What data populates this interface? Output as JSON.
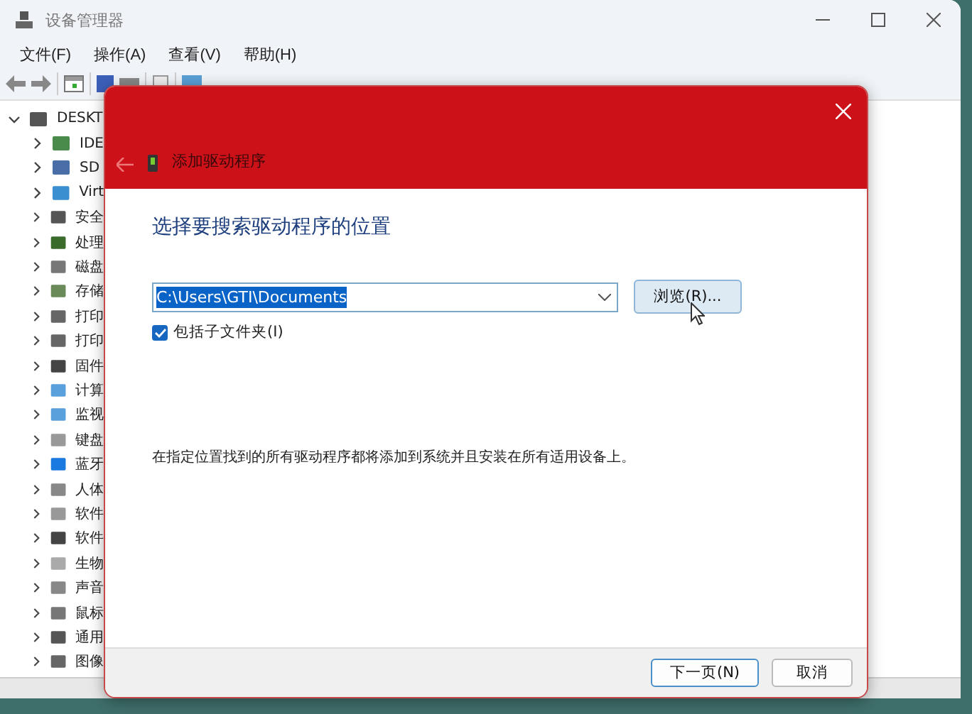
{
  "window": {
    "title": "设备管理器"
  },
  "menu": [
    "文件(F)",
    "操作(A)",
    "查看(V)",
    "帮助(H)"
  ],
  "tree": {
    "label": "DESKT",
    "expanded": true,
    "children": [
      {
        "label": "IDE",
        "expanded": false
      },
      {
        "label": "SD",
        "expanded": false
      },
      {
        "label": "Virt",
        "expanded": false
      },
      {
        "label": "安全",
        "expanded": false
      },
      {
        "label": "处理",
        "expanded": false
      },
      {
        "label": "磁盘",
        "expanded": false
      },
      {
        "label": "存储",
        "expanded": false
      },
      {
        "label": "打印",
        "expanded": false
      },
      {
        "label": "打印",
        "expanded": false
      },
      {
        "label": "固件",
        "expanded": false
      },
      {
        "label": "计算",
        "expanded": false
      },
      {
        "label": "监视",
        "expanded": false
      },
      {
        "label": "键盘",
        "expanded": false
      },
      {
        "label": "蓝牙",
        "expanded": false
      },
      {
        "label": "人体",
        "expanded": false
      },
      {
        "label": "软件",
        "expanded": false
      },
      {
        "label": "软件",
        "expanded": false
      },
      {
        "label": "生物",
        "expanded": false
      },
      {
        "label": "声音",
        "expanded": false
      },
      {
        "label": "鼠标",
        "expanded": false
      },
      {
        "label": "通用",
        "expanded": false
      },
      {
        "label": "图像",
        "expanded": false
      }
    ]
  },
  "dialog": {
    "title": "添加驱动程序",
    "heading": "选择要搜索驱动程序的位置",
    "path": {
      "value": "C:\\Users\\GTI\\Documents",
      "selected": true
    },
    "browse_button": "浏览(R)...",
    "include_subfolders": {
      "label": "包括子文件夹(I)",
      "checked": true
    },
    "note": "在指定位置找到的所有驱动程序都将添加到系统并且安装在所有适用设备上。",
    "buttons": [
      {
        "label": "下一页(N)",
        "default": true
      },
      {
        "label": "取消",
        "default": false
      }
    ]
  }
}
